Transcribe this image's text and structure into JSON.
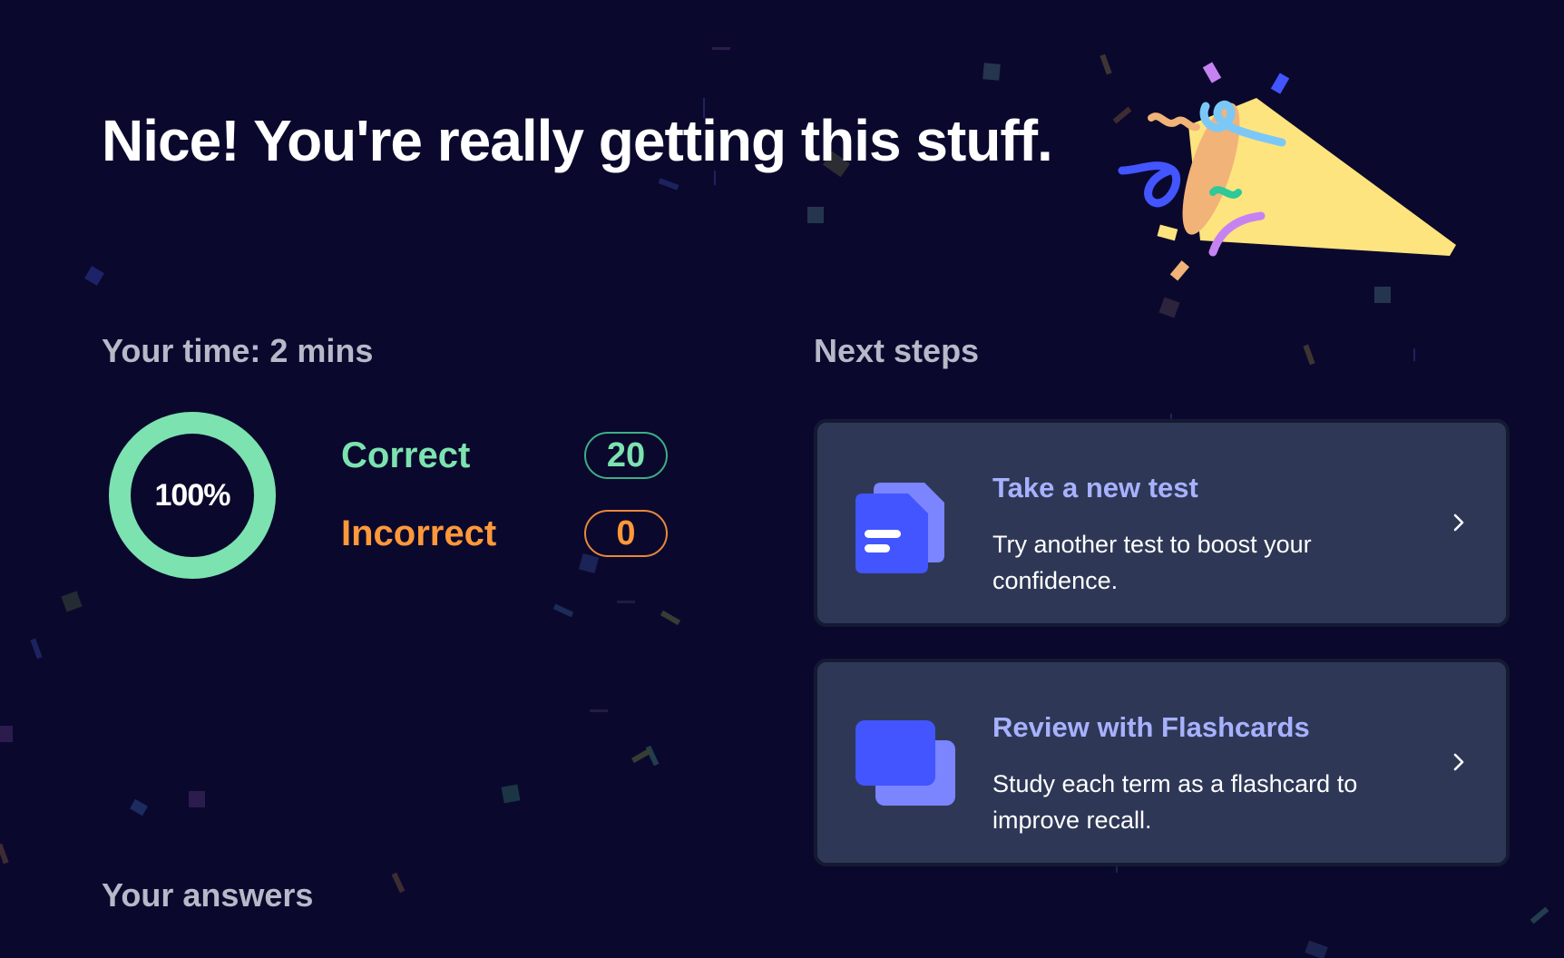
{
  "headline": "Nice! You're really getting this stuff.",
  "time": {
    "heading": "Your time: 2 mins"
  },
  "score": {
    "percent_label": "100%",
    "percent": 100,
    "correct_label": "Correct",
    "correct_count": "20",
    "incorrect_label": "Incorrect",
    "incorrect_count": "0"
  },
  "next_steps": {
    "heading": "Next steps",
    "cards": [
      {
        "title": "Take a new test",
        "description": "Try another test to boost your confidence.",
        "icon": "test-document-icon"
      },
      {
        "title": "Review with Flashcards",
        "description": "Study each term as a flashcard to improve recall.",
        "icon": "flashcards-icon"
      }
    ]
  },
  "answers": {
    "heading": "Your answers"
  },
  "colors": {
    "background": "#0a092d",
    "correct": "#7ce2b0",
    "incorrect": "#ff983a",
    "card": "#2e3856",
    "card_title": "#a8b1ff",
    "icon_primary": "#4255ff"
  }
}
